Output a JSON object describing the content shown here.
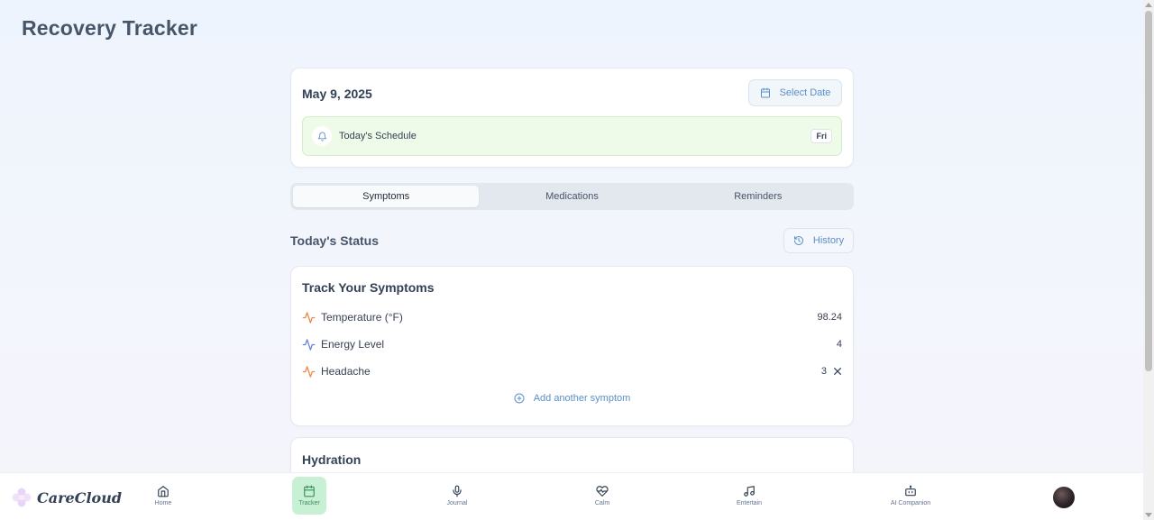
{
  "page": {
    "title": "Recovery Tracker"
  },
  "date_card": {
    "date": "May 9, 2025",
    "select_date_label": "Select Date",
    "schedule_label": "Today's Schedule",
    "day_badge": "Fri"
  },
  "tabs": [
    {
      "label": "Symptoms",
      "active": true
    },
    {
      "label": "Medications",
      "active": false
    },
    {
      "label": "Reminders",
      "active": false
    }
  ],
  "status": {
    "title": "Today's Status",
    "history_label": "History"
  },
  "symptoms_card": {
    "title": "Track Your Symptoms",
    "items": [
      {
        "name": "Temperature (°F)",
        "value": "98.24",
        "icon": "activity-icon",
        "color": "#f0874a",
        "removable": false
      },
      {
        "name": "Energy Level",
        "value": "4",
        "icon": "activity-icon",
        "color": "#6b7fd7",
        "removable": false
      },
      {
        "name": "Headache",
        "value": "3",
        "icon": "activity-icon",
        "color": "#f0874a",
        "removable": true
      }
    ],
    "add_label": "Add another symptom"
  },
  "hydration_card": {
    "title": "Hydration"
  },
  "nav": {
    "logo_text": "CareCloud",
    "items": [
      {
        "label": "Home",
        "icon": "home-icon",
        "active": false
      },
      {
        "label": "Tracker",
        "icon": "calendar-icon",
        "active": true
      },
      {
        "label": "Journal",
        "icon": "microphone-icon",
        "active": false
      },
      {
        "label": "Calm",
        "icon": "heart-pulse-icon",
        "active": false
      },
      {
        "label": "Entertain",
        "icon": "music-icon",
        "active": false
      },
      {
        "label": "AI Companion",
        "icon": "robot-icon",
        "active": false
      }
    ]
  },
  "colors": {
    "accent_blue": "#5b8fc7",
    "schedule_green": "#eefbe8",
    "nav_active": "#c8f0d4",
    "symptom_orange": "#f0874a",
    "symptom_purple": "#6b7fd7"
  }
}
